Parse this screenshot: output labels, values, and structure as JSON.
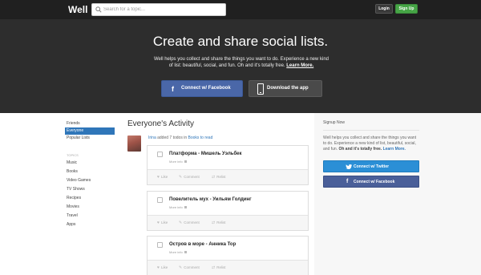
{
  "header": {
    "logo": "Well",
    "search_placeholder": "Search for a topic...",
    "login_label": "Login",
    "signup_label": "Sign Up"
  },
  "hero": {
    "title": "Create and share social lists.",
    "description": "Well helps you collect and share the things you want to do. Experience a new kind of list: beautiful, social, and fun. Oh and it's totally free.",
    "learn_more": "Learn More.",
    "facebook_button": "Connect w/ Facebook",
    "download_button": "Download the app"
  },
  "sidebar": {
    "items": [
      {
        "label": "Friends"
      },
      {
        "label": "Everyone"
      },
      {
        "label": "Popular Lists"
      }
    ],
    "topics_heading": "TOPICS",
    "topics": [
      "Music",
      "Books",
      "Video Games",
      "TV Shows",
      "Recipes",
      "Movies",
      "Travel",
      "Apps"
    ]
  },
  "activity": {
    "heading": "Everyone's Activity",
    "user": "Irina",
    "action_text": " added 7 todos in ",
    "list_name": "Books to read",
    "more_info": "More info",
    "actions": {
      "like": "Like",
      "comment": "Comment",
      "relist": "Relist"
    },
    "items": [
      {
        "title": "Платформа - Мишель Уэльбек"
      },
      {
        "title": "Повелитель мух - Уильям Голдинг"
      },
      {
        "title": "Остров в море - Анника Тор"
      }
    ]
  },
  "signup": {
    "heading": "Signup Now",
    "text_prefix": "Well helps you collect and share the things you want to do. Experience a new kind of list, beautiful, social, and fun. ",
    "text_bold": "Oh and it's totally free. ",
    "learn_more": "Learn More.",
    "twitter_button": "Connect w/ Twitter",
    "facebook_button": "Connect w/ Facebook"
  },
  "colors": {
    "accent": "#2f76b9",
    "signup_green": "#46a546",
    "facebook": "#4a67a8",
    "twitter": "#2b8fd6"
  }
}
